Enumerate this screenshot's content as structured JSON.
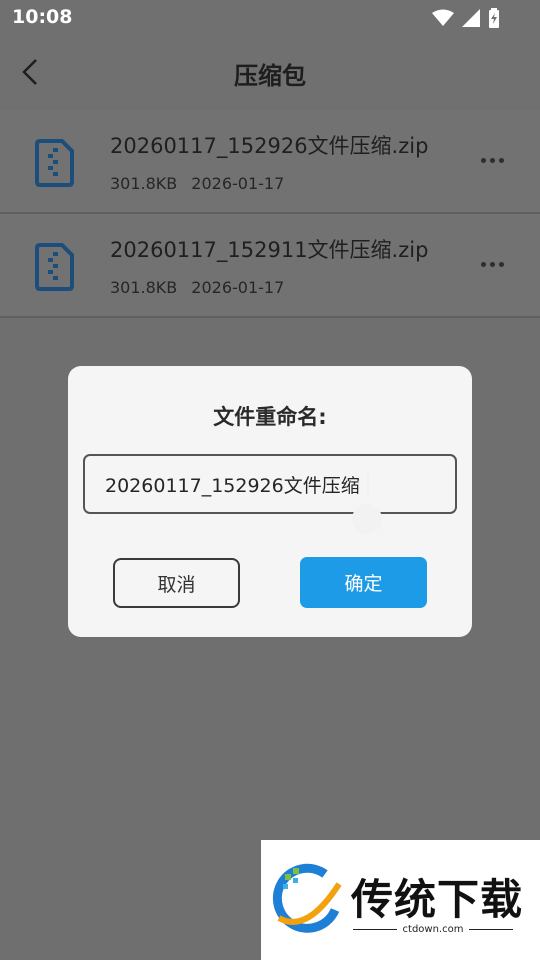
{
  "status_bar": {
    "time": "10:08",
    "icons": [
      "wifi-icon",
      "signal-icon",
      "battery-icon"
    ]
  },
  "header": {
    "title": "压缩包",
    "back_icon": "back-arrow-icon"
  },
  "files": [
    {
      "name": "20260117_152926文件压缩.zip",
      "size": "301.8KB",
      "date": "2026-01-17"
    },
    {
      "name": "20260117_152911文件压缩.zip",
      "size": "301.8KB",
      "date": "2026-01-17"
    }
  ],
  "dialog": {
    "title": "文件重命名:",
    "input_value": "20260117_152926文件压缩",
    "cancel_label": "取消",
    "confirm_label": "确定"
  },
  "watermark": {
    "text": "传统下载",
    "url": "ctdown.com"
  },
  "colors": {
    "accent": "#1e9be6",
    "file_icon": "#1c4e7c"
  }
}
